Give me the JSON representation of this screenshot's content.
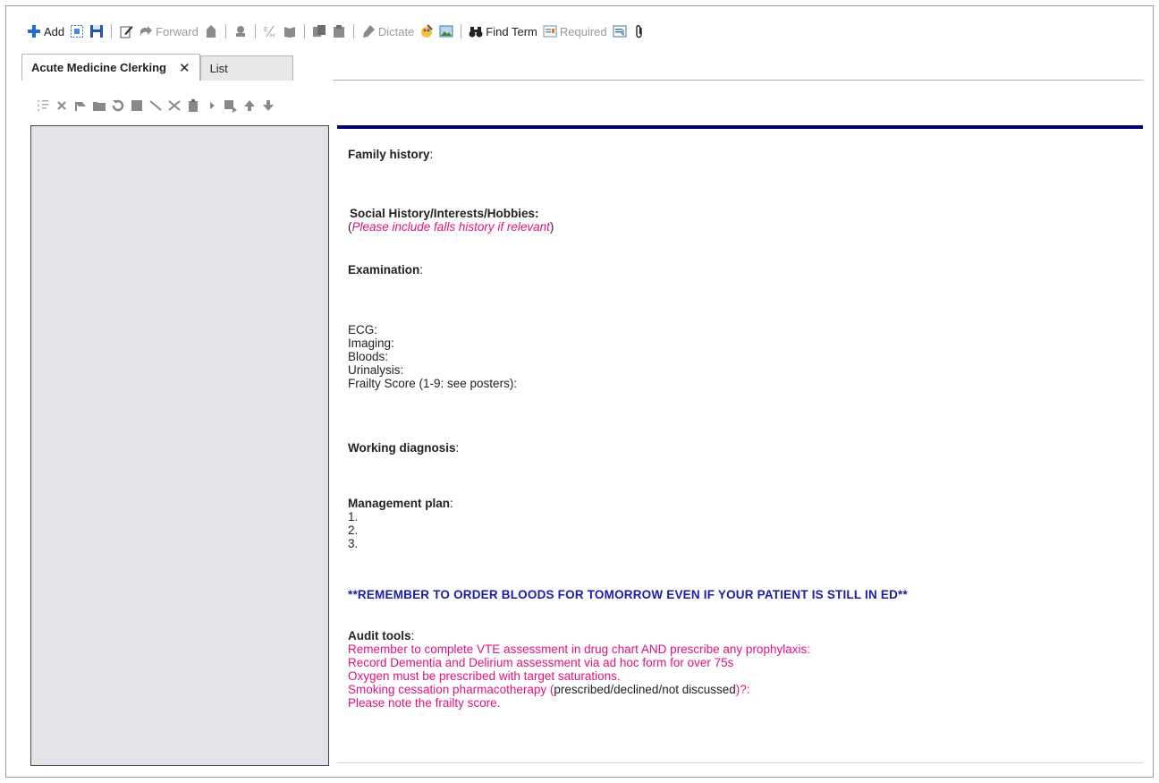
{
  "toolbar": {
    "add_label": "Add",
    "forward_label": "Forward",
    "dictate_label": "Dictate",
    "find_term_label": "Find Term",
    "required_label": "Required"
  },
  "tabs": [
    {
      "label": "Acute Medicine Clerking",
      "close": "✕"
    },
    {
      "label": "List"
    }
  ],
  "note": {
    "family_history": {
      "title": "Family history",
      "suffix": ":"
    },
    "social_history": {
      "title": "Social History/Interests/Hobbies:",
      "open": "(",
      "hint": "Please include falls history if relevant",
      "close": ")"
    },
    "examination": {
      "title": "Examination",
      "suffix": ":"
    },
    "investigations": [
      "ECG:",
      "Imaging:",
      "Bloods:",
      "Urinalysis:",
      "Frailty Score (1-9: see posters):"
    ],
    "working_diagnosis": {
      "title": "Working diagnosis",
      "suffix": ":"
    },
    "management_plan": {
      "title": "Management plan",
      "suffix": ":",
      "items": [
        "1.",
        "2.",
        "3."
      ]
    },
    "reminder": "**REMEMBER TO ORDER BLOODS FOR TOMORROW EVEN IF YOUR PATIENT IS STILL IN ED**",
    "audit_tools": {
      "title": "Audit tools",
      "suffix": ":",
      "line1": "Remember to complete VTE assessment in drug chart AND prescribe any prophylaxis:",
      "line2": "Record Dementia and Delirium assessment via ad hoc form for over 75s",
      "line3": "Oxygen must be prescribed with target saturations.",
      "line4_pre": "Smoking cessation pharmacotherapy (",
      "line4_mid": "prescribed/declined/not discussed",
      "line4_post": ")?:",
      "line5": "Please note the frailty score."
    }
  },
  "colors": {
    "accent_bar": "#00006e",
    "hint_pink": "#e0127e",
    "reminder_blue": "#1c1ca8",
    "left_pane": "#e1e3e8"
  }
}
